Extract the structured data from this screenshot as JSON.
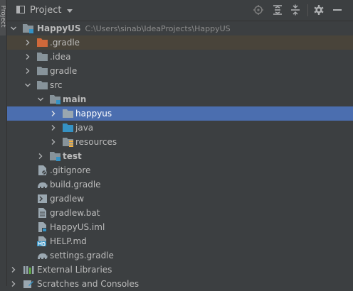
{
  "side_tab": {
    "label": "Project"
  },
  "header": {
    "title": "Project"
  },
  "colors": {
    "background": "#3c3f41",
    "selection": "#4b6eaf",
    "excluded": "#49443a",
    "folder": "#87939a",
    "source_root": "#3592c4",
    "excluded_folder": "#d0693a"
  },
  "tree": [
    {
      "label": "HappyUS",
      "path": "C:\\Users\\sinab\\IdeaProjects\\HappyUS",
      "icon": "module-folder-icon",
      "expanded": true
    },
    {
      "label": ".gradle",
      "icon": "excluded-folder-icon",
      "expanded": false
    },
    {
      "label": ".idea",
      "icon": "folder-icon",
      "expanded": false
    },
    {
      "label": "gradle",
      "icon": "folder-icon",
      "expanded": false
    },
    {
      "label": "src",
      "icon": "folder-icon",
      "expanded": true
    },
    {
      "label": "main",
      "icon": "module-folder-icon",
      "expanded": true
    },
    {
      "label": "happyus",
      "icon": "package-folder-icon",
      "expanded": false
    },
    {
      "label": "java",
      "icon": "source-root-folder-icon",
      "expanded": false
    },
    {
      "label": "resources",
      "icon": "resources-folder-icon",
      "expanded": false
    },
    {
      "label": "test",
      "icon": "module-folder-icon",
      "expanded": false
    },
    {
      "label": ".gitignore",
      "icon": "ignore-file-icon"
    },
    {
      "label": "build.gradle",
      "icon": "gradle-file-icon"
    },
    {
      "label": "gradlew",
      "icon": "shell-file-icon"
    },
    {
      "label": "gradlew.bat",
      "icon": "text-file-icon"
    },
    {
      "label": "HappyUS.iml",
      "icon": "iml-file-icon"
    },
    {
      "label": "HELP.md",
      "icon": "markdown-file-icon"
    },
    {
      "label": "settings.gradle",
      "icon": "gradle-file-icon"
    },
    {
      "label": "External Libraries",
      "icon": "libraries-icon",
      "expanded": false
    },
    {
      "label": "Scratches and Consoles",
      "icon": "scratches-icon",
      "expanded": false
    }
  ]
}
